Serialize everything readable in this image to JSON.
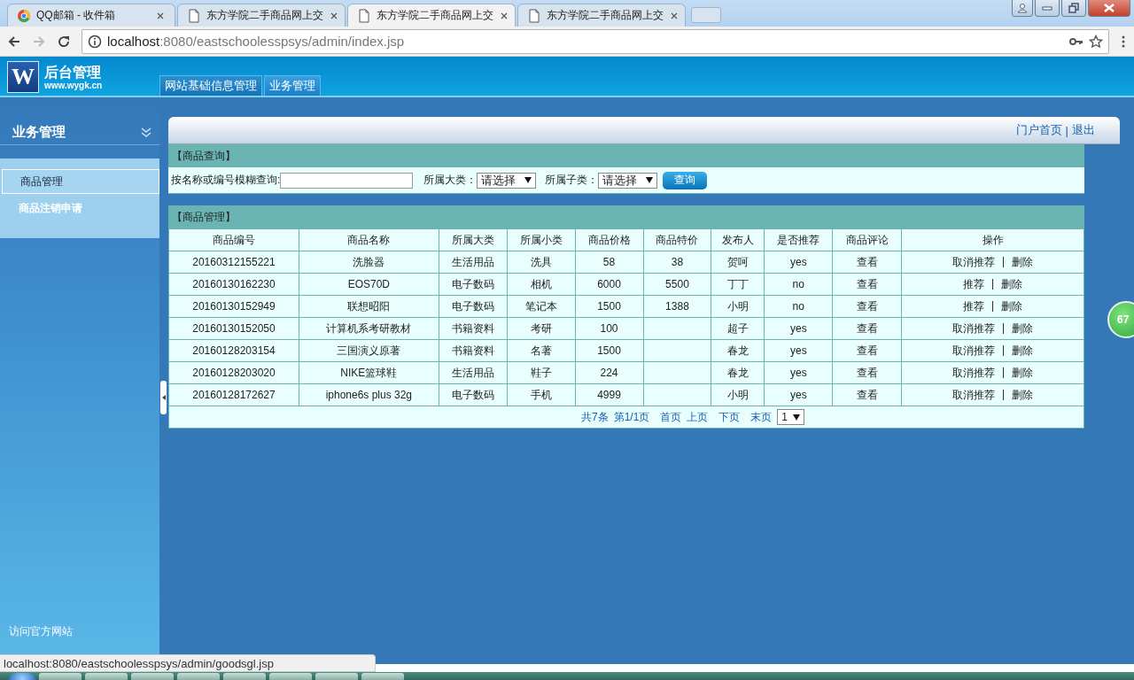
{
  "browser": {
    "tabs": [
      {
        "title": "QQ邮箱 - 收件箱",
        "kind": "mail",
        "selected": false
      },
      {
        "title": "东方学院二手商品网上交",
        "kind": "page",
        "selected": false
      },
      {
        "title": "东方学院二手商品网上交",
        "kind": "page",
        "selected": true
      },
      {
        "title": "东方学院二手商品网上交",
        "kind": "page",
        "selected": false
      }
    ],
    "url": {
      "host": "localhost",
      "path": ":8080/eastschoolesspsys/admin/index.jsp"
    }
  },
  "header": {
    "logo_letter": "W",
    "title": "后台管理",
    "subtitle": "www.wygk.cn",
    "nav_tabs": [
      {
        "label": "网站基础信息管理",
        "selected": false
      },
      {
        "label": "业务管理",
        "selected": true
      }
    ]
  },
  "sidebar": {
    "title": "业务管理",
    "items": [
      {
        "label": "商品管理",
        "selected": true
      },
      {
        "label": "商品注销申请",
        "selected": false
      }
    ],
    "footer_link": "访问官方网站"
  },
  "top_links": {
    "first": "门户首页",
    "separator": "|",
    "second": "退出"
  },
  "query_panel": {
    "title": "【商品查询】",
    "field_label": "按名称或编号模糊查询:",
    "category_label": "所属大类：",
    "category_value": "请选择",
    "subcategory_label": "所属子类：",
    "subcategory_value": "请选择",
    "button": "查询"
  },
  "goods_panel": {
    "title": "【商品管理】",
    "columns": [
      "商品编号",
      "商品名称",
      "所属大类",
      "所属小类",
      "商品价格",
      "商品特价",
      "发布人",
      "是否推荐",
      "商品评论",
      "操作"
    ],
    "rows": [
      {
        "cells": [
          "20160312155221",
          "洗脸器",
          "生活用品",
          "洗具",
          "58",
          "38",
          "贺呵",
          "yes",
          "查看"
        ],
        "action_1": "取消推荐",
        "separator": "|",
        "action_2": "删除"
      },
      {
        "cells": [
          "20160130162230",
          "EOS70D",
          "电子数码",
          "相机",
          "6000",
          "5500",
          "丁丁",
          "no",
          "查看"
        ],
        "action_1": "推荐",
        "separator": "|",
        "action_2": "删除"
      },
      {
        "cells": [
          "20160130152949",
          "联想昭阳",
          "电子数码",
          "笔记本",
          "1500",
          "1388",
          "小明",
          "no",
          "查看"
        ],
        "action_1": "推荐",
        "separator": "|",
        "action_2": "删除"
      },
      {
        "cells": [
          "20160130152050",
          "计算机系考研教材",
          "书籍资料",
          "考研",
          "100",
          "",
          "超子",
          "yes",
          "查看"
        ],
        "action_1": "取消推荐",
        "separator": "|",
        "action_2": "删除"
      },
      {
        "cells": [
          "20160128203154",
          "三国演义原著",
          "书籍资料",
          "名著",
          "1500",
          "",
          "春龙",
          "yes",
          "查看"
        ],
        "action_1": "取消推荐",
        "separator": "|",
        "action_2": "删除"
      },
      {
        "cells": [
          "20160128203020",
          "NIKE篮球鞋",
          "生活用品",
          "鞋子",
          "224",
          "",
          "春龙",
          "yes",
          "查看"
        ],
        "action_1": "取消推荐",
        "separator": "|",
        "action_2": "删除"
      },
      {
        "cells": [
          "20160128172627",
          "iphone6s plus 32g",
          "电子数码",
          "手机",
          "4999",
          "",
          "小明",
          "yes",
          "查看"
        ],
        "action_1": "取消推荐",
        "separator": "|",
        "action_2": "删除"
      }
    ],
    "pagination": {
      "total": "共7条",
      "page": "第1/1页",
      "first": "首页",
      "prev": "上页",
      "next": "下页",
      "last": "末页",
      "page_select": "1"
    }
  },
  "float_ball": "67",
  "status_url": "localhost:8080/eastschoolesspsys/admin/goodsgl.jsp"
}
